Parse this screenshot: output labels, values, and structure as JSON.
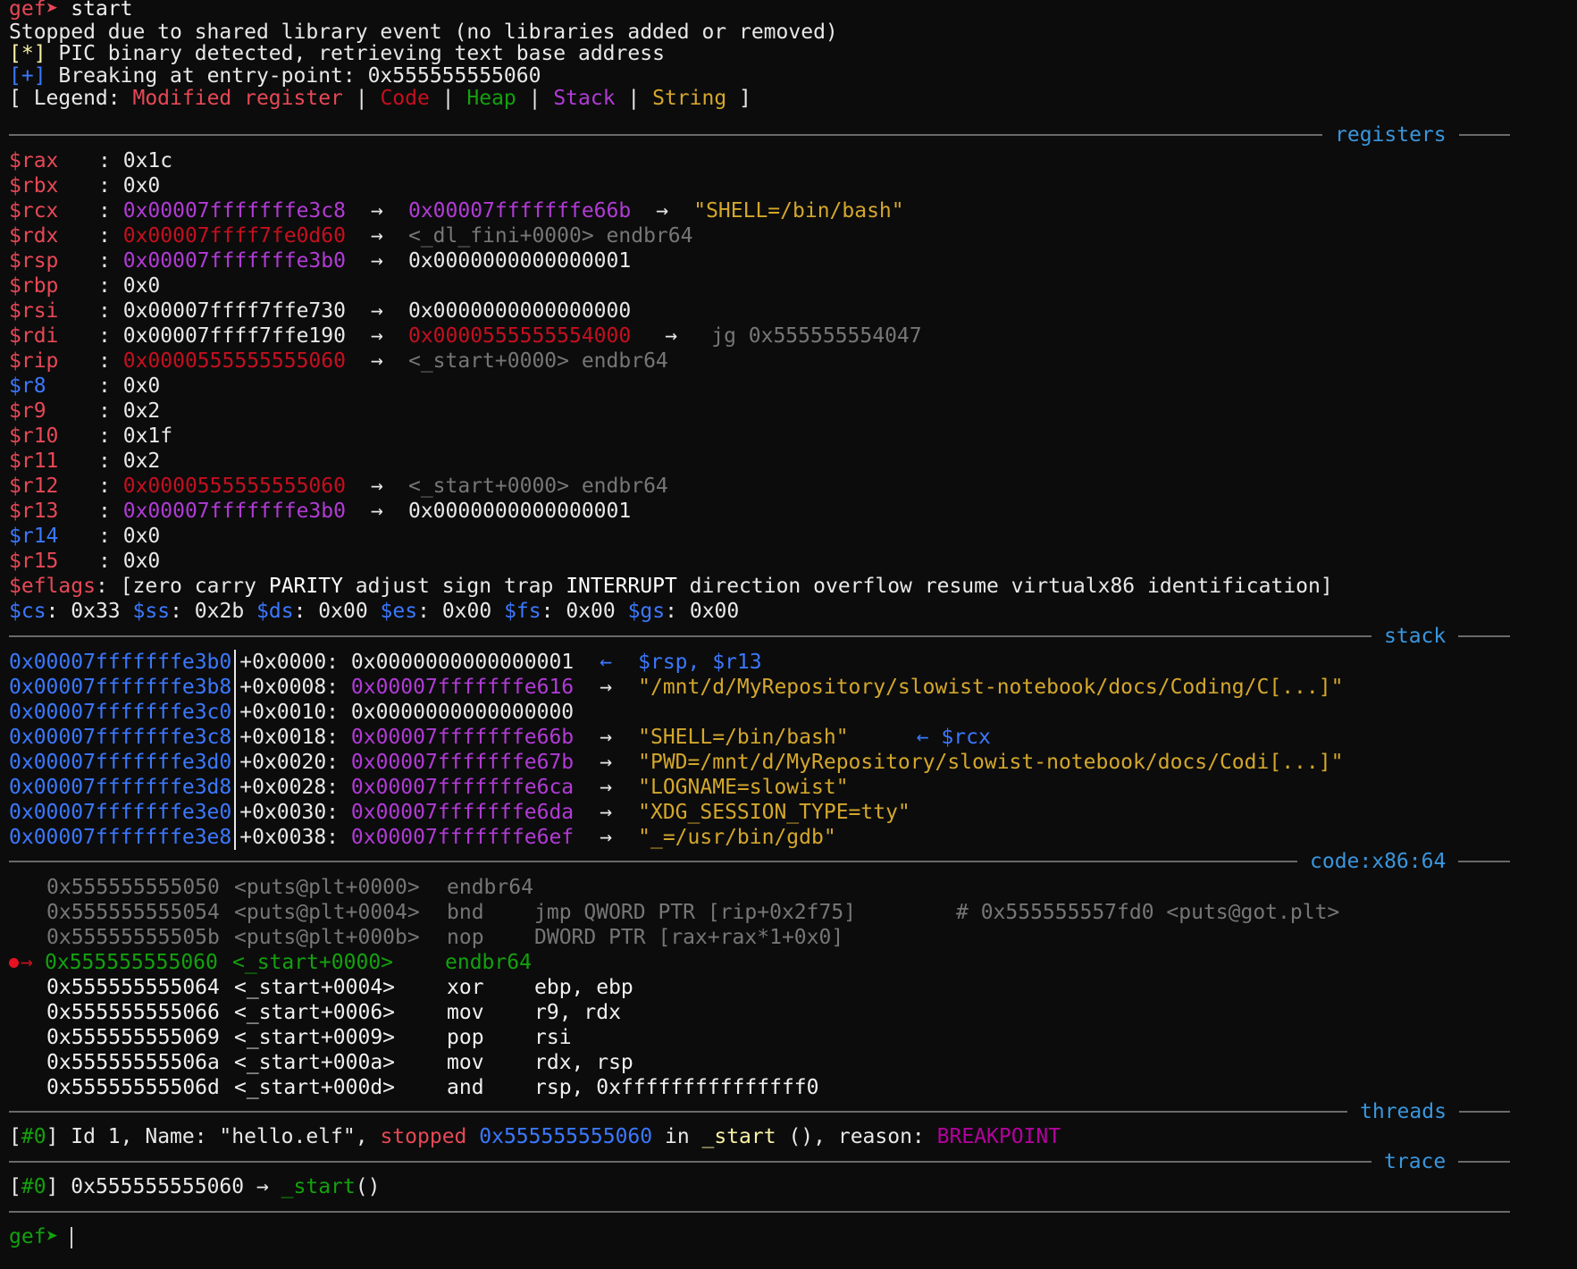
{
  "header": {
    "prompt": "gef➤",
    "command": "start",
    "msg1": "Stopped due to shared library event (no libraries added or removed)",
    "msg2_tag": "[*]",
    "msg2_text": "PIC binary detected, retrieving text base address",
    "msg3_tag": "[+]",
    "msg3_text": "Breaking at entry-point: 0x555555555060"
  },
  "legend": {
    "open": "[ Legend: ",
    "modified": "Modified register",
    "code": "Code",
    "heap": "Heap",
    "stack": "Stack",
    "string": "String",
    "pipe": " | ",
    "close": " ]"
  },
  "sections": {
    "registers": "registers",
    "stack": "stack",
    "code": "code:x86:64",
    "threads": "threads",
    "trace": "trace"
  },
  "registers": [
    {
      "name": "$rax",
      "v1": "0x1c"
    },
    {
      "name": "$rbx",
      "v1": "0x0"
    },
    {
      "name": "$rcx",
      "v1": "0x00007fffffffe3c8",
      "a1": "→",
      "v2": "0x00007fffffffe66b",
      "a2": "→",
      "v3": "\"SHELL=/bin/bash\""
    },
    {
      "name": "$rdx",
      "v1": "0x00007ffff7fe0d60",
      "a1": "→",
      "v2": "<_dl_fini+0000> endbr64"
    },
    {
      "name": "$rsp",
      "v1": "0x00007fffffffe3b0",
      "a1": "→",
      "v2": "0x0000000000000001"
    },
    {
      "name": "$rbp",
      "v1": "0x0"
    },
    {
      "name": "$rsi",
      "v1": "0x00007ffff7ffe730",
      "a1": "→",
      "v2": "0x0000000000000000"
    },
    {
      "name": "$rdi",
      "v1": "0x00007ffff7ffe190",
      "a1": "→",
      "v2": "0x0000555555554000",
      "a2": "→",
      "v3": "jg 0x555555554047"
    },
    {
      "name": "$rip",
      "v1": "0x0000555555555060",
      "a1": "→",
      "v2": "<_start+0000> endbr64"
    },
    {
      "name": "$r8",
      "v1": "0x0"
    },
    {
      "name": "$r9",
      "v1": "0x2"
    },
    {
      "name": "$r10",
      "v1": "0x1f"
    },
    {
      "name": "$r11",
      "v1": "0x2"
    },
    {
      "name": "$r12",
      "v1": "0x0000555555555060",
      "a1": "→",
      "v2": "<_start+0000> endbr64"
    },
    {
      "name": "$r13",
      "v1": "0x00007fffffffe3b0",
      "a1": "→",
      "v2": "0x0000000000000001"
    },
    {
      "name": "$r14",
      "v1": "0x0"
    },
    {
      "name": "$r15",
      "v1": "0x0"
    }
  ],
  "colon": ":",
  "eflags": {
    "name": "$eflags",
    "open": "[",
    "f1": "zero carry ",
    "f2": "PARITY",
    "f3": " adjust sign trap ",
    "f4": "INTERRUPT",
    "f5": " direction overflow resume virtualx86 identification",
    "close": "]"
  },
  "segments": [
    {
      "name": "$cs",
      "value": "0x33"
    },
    {
      "name": "$ss",
      "value": "0x2b"
    },
    {
      "name": "$ds",
      "value": "0x00"
    },
    {
      "name": "$es",
      "value": "0x00"
    },
    {
      "name": "$fs",
      "value": "0x00"
    },
    {
      "name": "$gs",
      "value": "0x00"
    }
  ],
  "stack": [
    {
      "addr": "0x00007fffffffe3b0",
      "off": "+0x0000:",
      "val": "0x0000000000000001",
      "arrow": "←",
      "note": "$rsp, $r13"
    },
    {
      "addr": "0x00007fffffffe3b8",
      "off": "+0x0008:",
      "val": "0x00007fffffffe616",
      "arrow": "→",
      "str": "\"/mnt/d/MyRepository/slowist-notebook/docs/Coding/C[...]\""
    },
    {
      "addr": "0x00007fffffffe3c0",
      "off": "+0x0010:",
      "val": "0x0000000000000000"
    },
    {
      "addr": "0x00007fffffffe3c8",
      "off": "+0x0018:",
      "val": "0x00007fffffffe66b",
      "arrow": "→",
      "str": "\"SHELL=/bin/bash\"",
      "arrow2": "←",
      "note": "$rcx"
    },
    {
      "addr": "0x00007fffffffe3d0",
      "off": "+0x0020:",
      "val": "0x00007fffffffe67b",
      "arrow": "→",
      "str": "\"PWD=/mnt/d/MyRepository/slowist-notebook/docs/Codi[...]\""
    },
    {
      "addr": "0x00007fffffffe3d8",
      "off": "+0x0028:",
      "val": "0x00007fffffffe6ca",
      "arrow": "→",
      "str": "\"LOGNAME=slowist\""
    },
    {
      "addr": "0x00007fffffffe3e0",
      "off": "+0x0030:",
      "val": "0x00007fffffffe6da",
      "arrow": "→",
      "str": "\"XDG_SESSION_TYPE=tty\""
    },
    {
      "addr": "0x00007fffffffe3e8",
      "off": "+0x0038:",
      "val": "0x00007fffffffe6ef",
      "arrow": "→",
      "str": "\"_=/usr/bin/gdb\""
    }
  ],
  "code": [
    {
      "addr": "0x555555555050",
      "sym": "<puts@plt+0000>",
      "mn": "endbr64",
      "ops": "",
      "cmt": ""
    },
    {
      "addr": "0x555555555054",
      "sym": "<puts@plt+0004>",
      "mn": "bnd",
      "ops": "jmp QWORD PTR [rip+0x2f75]",
      "cmt": "# 0x555555557fd0 <puts@got.plt>"
    },
    {
      "addr": "0x55555555505b",
      "sym": "<puts@plt+000b>",
      "mn": "nop",
      "ops": "DWORD PTR [rax+rax*1+0x0]",
      "cmt": ""
    },
    {
      "addr": "0x555555555060",
      "sym": "<_start+0000>",
      "mn": "endbr64",
      "ops": "",
      "cmt": "",
      "current": true,
      "marker": "→"
    },
    {
      "addr": "0x555555555064",
      "sym": "<_start+0004>",
      "mn": "xor",
      "ops": "ebp, ebp",
      "cmt": ""
    },
    {
      "addr": "0x555555555066",
      "sym": "<_start+0006>",
      "mn": "mov",
      "ops": "r9, rdx",
      "cmt": ""
    },
    {
      "addr": "0x555555555069",
      "sym": "<_start+0009>",
      "mn": "pop",
      "ops": "rsi",
      "cmt": ""
    },
    {
      "addr": "0x55555555506a",
      "sym": "<_start+000a>",
      "mn": "mov",
      "ops": "rdx, rsp",
      "cmt": ""
    },
    {
      "addr": "0x55555555506d",
      "sym": "<_start+000d>",
      "mn": "and",
      "ops": "rsp, 0xfffffffffffffff0",
      "cmt": ""
    }
  ],
  "threads": {
    "idx": "[#0]",
    "t1": " Id 1, Name: \"hello.elf\", ",
    "stopped": "stopped",
    "addr": "0x555555555060",
    "in": " in ",
    "func": "_start",
    "t2": " (), reason: ",
    "reason": "BREAKPOINT"
  },
  "trace": {
    "idx": "[#0]",
    "addr": " 0x555555555060 → ",
    "func": "_start",
    "paren": "()"
  },
  "footer": {
    "prompt": "gef➤"
  }
}
